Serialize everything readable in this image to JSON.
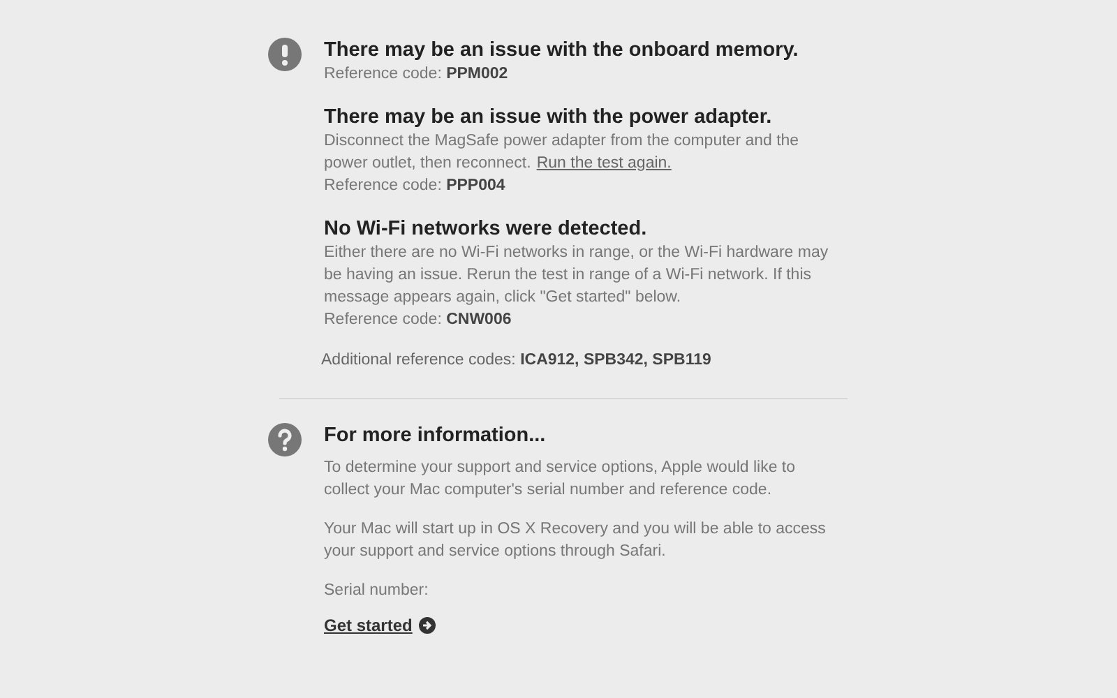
{
  "issues_section": {
    "issues": [
      {
        "title": "There may be an issue with the onboard memory.",
        "reference": "Reference code: **PPM002**"
      },
      {
        "title": "There may be an issue with the power adapter.",
        "description": "Disconnect the MagSafe power adapter from the computer and the power outlet, then reconnect.",
        "link": "Run the test again.",
        "reference": "Reference code: **PPP004**"
      },
      {
        "title": "No Wi-Fi networks were detected.",
        "description": "Either there are no Wi-Fi networks in range, or the Wi-Fi hardware may be having an issue. Rerun the test in range of a Wi-Fi network. If this message appears again, click \"Get started\" below.",
        "reference": "Reference code: **CNW006**"
      }
    ],
    "additional": "Additional reference codes: **ICA912, SPB342, SPB119**"
  },
  "info_section": {
    "title": "For more information...",
    "paragraphs": [
      "To determine your support and service options, Apple would like to collect your Mac computer's serial number and reference code.",
      "Your Mac will start up in OS X Recovery and you will be able to access your support and service options through Safari."
    ],
    "serial_label": "Serial number:",
    "action": "Get started"
  }
}
